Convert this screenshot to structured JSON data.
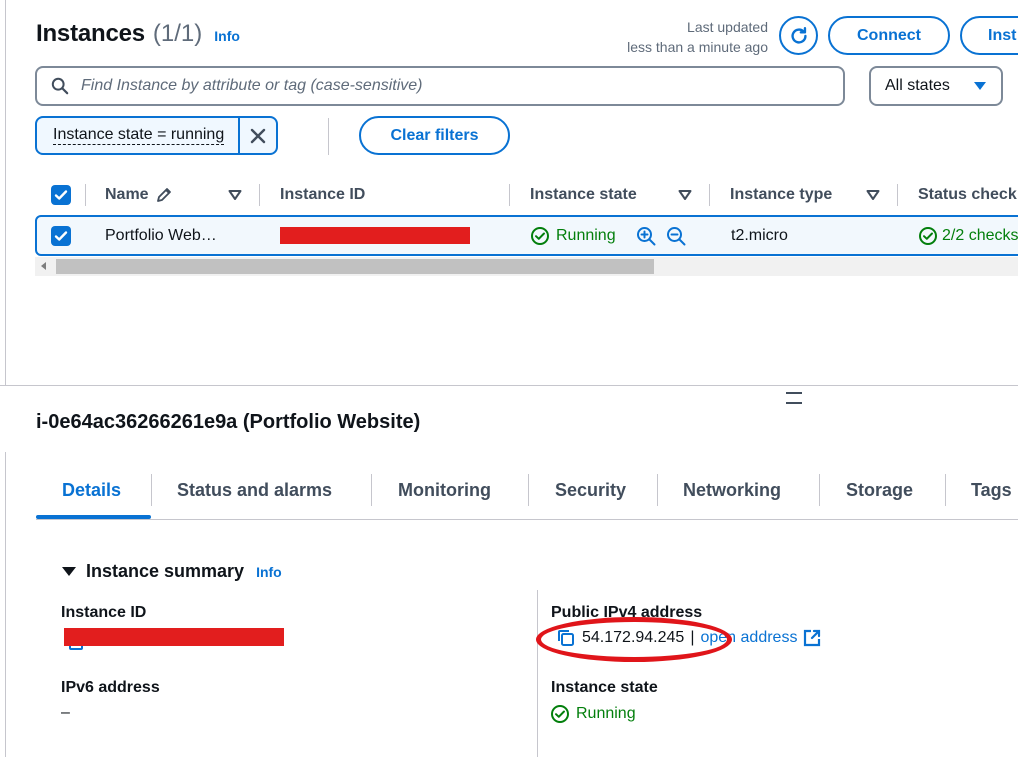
{
  "header": {
    "title": "Instances",
    "count": "(1/1)",
    "info": "Info",
    "last_updated_line1": "Last updated",
    "last_updated_line2": "less than a minute ago",
    "connect_label": "Connect",
    "instance_state_btn_label": "Inst"
  },
  "search": {
    "placeholder": "Find Instance by attribute or tag (case-sensitive)",
    "states_value": "All states"
  },
  "filters": {
    "token_label": "Instance state = running",
    "clear_label": "Clear filters"
  },
  "table": {
    "columns": [
      "Name",
      "Instance ID",
      "Instance state",
      "Instance type",
      "Status check"
    ],
    "rows": [
      {
        "name": "Portfolio Web…",
        "instance_id": "",
        "state": "Running",
        "type": "t2.micro",
        "status_check": "2/2 checks"
      }
    ]
  },
  "details": {
    "title": "i-0e64ac36266261e9a (Portfolio Website)",
    "tabs": [
      "Details",
      "Status and alarms",
      "Monitoring",
      "Security",
      "Networking",
      "Storage",
      "Tags"
    ],
    "summary_title": "Instance summary",
    "summary_info": "Info",
    "instance_id_label": "Instance ID",
    "public_ipv4_label": "Public IPv4 address",
    "public_ipv4_value": "54.172.94.245",
    "open_address": "open address",
    "ipv6_label": "IPv6 address",
    "ipv6_value": "–",
    "instance_state_label": "Instance state",
    "instance_state_value": "Running"
  },
  "colors": {
    "accent": "#0972d3",
    "success": "#037f0c",
    "redaction": "#e21e1e",
    "annotation": "#e0151a"
  }
}
